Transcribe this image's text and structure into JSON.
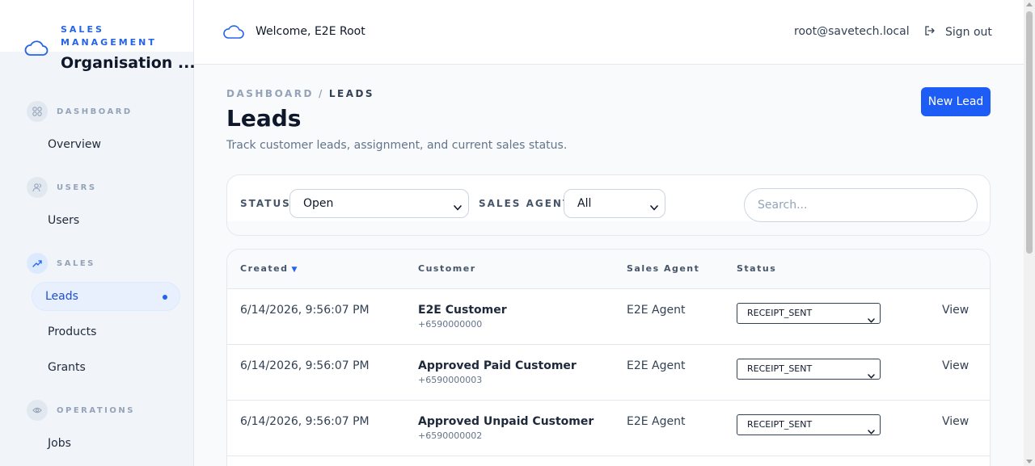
{
  "brand": {
    "subtitle": "SALES MANAGEMENT",
    "title": "Organisation ..."
  },
  "sidebar": {
    "sections": [
      {
        "label": "DASHBOARD",
        "icon": "grid-icon",
        "items": [
          {
            "label": "Overview"
          }
        ]
      },
      {
        "label": "USERS",
        "icon": "users-icon",
        "items": [
          {
            "label": "Users"
          }
        ]
      },
      {
        "label": "SALES",
        "icon": "trending-up-icon",
        "items": [
          {
            "label": "Leads",
            "active": true
          },
          {
            "label": "Products"
          },
          {
            "label": "Grants"
          }
        ]
      },
      {
        "label": "OPERATIONS",
        "icon": "eye-icon",
        "items": [
          {
            "label": "Jobs"
          }
        ]
      }
    ]
  },
  "topbar": {
    "welcome": "Welcome, E2E Root",
    "email": "root@savetech.local",
    "signout_label": "Sign out"
  },
  "page": {
    "breadcrumb": [
      "DASHBOARD",
      "LEADS"
    ],
    "breadcrumb_sep": "/",
    "title": "Leads",
    "subtitle": "Track customer leads, assignment, and current sales status.",
    "new_button": "New Lead"
  },
  "filters": {
    "status_label": "STATUS",
    "status_value": "Open",
    "agent_label": "SALES AGENT",
    "agent_value": "All",
    "search_placeholder": "Search..."
  },
  "table": {
    "columns": [
      "Created",
      "Customer",
      "Sales Agent",
      "Status"
    ],
    "sort_indicator": "▼",
    "rows": [
      {
        "created": "6/14/2026, 9:56:07 PM",
        "customer": "E2E Customer",
        "phone": "+6590000000",
        "agent": "E2E Agent",
        "status": "RECEIPT_SENT",
        "action": "View"
      },
      {
        "created": "6/14/2026, 9:56:07 PM",
        "customer": "Approved Paid Customer",
        "phone": "+6590000003",
        "agent": "E2E Agent",
        "status": "RECEIPT_SENT",
        "action": "View"
      },
      {
        "created": "6/14/2026, 9:56:07 PM",
        "customer": "Approved Unpaid Customer",
        "phone": "+6590000002",
        "agent": "E2E Agent",
        "status": "RECEIPT_SENT",
        "action": "View"
      }
    ]
  },
  "colors": {
    "accent": "#1d5cf5",
    "sidebar_bg": "#f1f5f9",
    "active_bg": "#e8f0fe"
  }
}
